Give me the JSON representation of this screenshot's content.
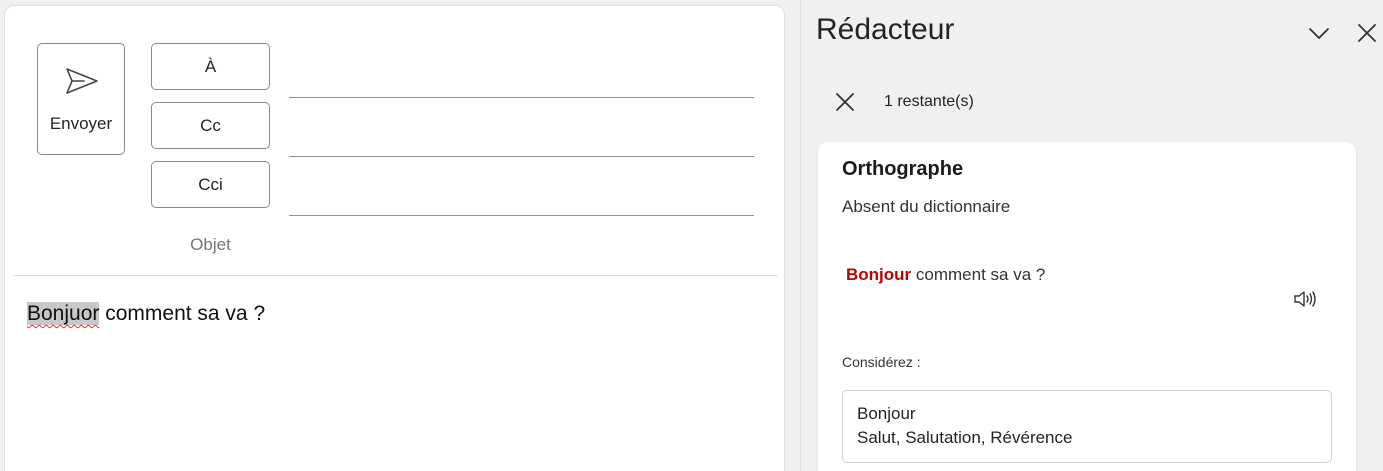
{
  "compose": {
    "send_label": "Envoyer",
    "to_label": "À",
    "cc_label": "Cc",
    "bcc_label": "Cci",
    "subject_label": "Objet",
    "body": {
      "misspelled_word": "Bonjuor",
      "rest": " comment sa va ?"
    }
  },
  "editor": {
    "title": "Rédacteur",
    "remaining": "1 restante(s)",
    "card": {
      "title": "Orthographe",
      "subtitle": "Absent du dictionnaire",
      "context_word": "Bonjour",
      "context_rest": " comment sa va ?",
      "consider_label": "Considérez :",
      "suggestion_word": "Bonjour",
      "suggestion_synonyms": "Salut, Salutation, Révérence"
    }
  },
  "icons": {
    "send": "send-icon",
    "collapse": "chevron-down-icon",
    "close": "close-icon",
    "dismiss": "close-icon",
    "speaker": "speaker-icon"
  },
  "colors": {
    "error_red": "#c00000",
    "squiggle_red": "#d13438",
    "highlight_gray": "#c8c8c8"
  }
}
